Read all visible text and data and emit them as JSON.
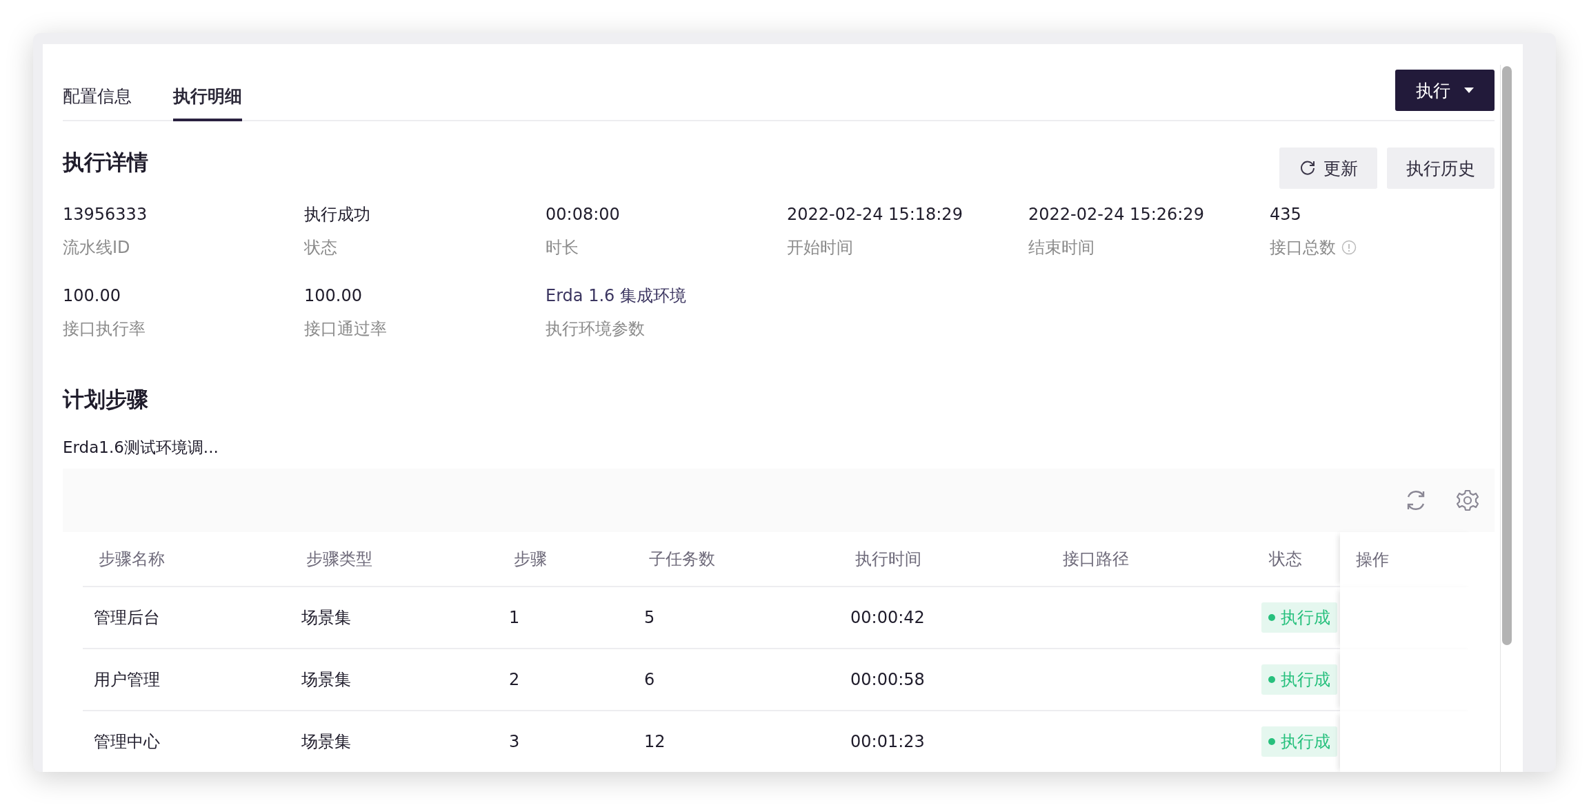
{
  "tabs": [
    {
      "label": "配置信息",
      "selected": false
    },
    {
      "label": "执行明细",
      "selected": true
    }
  ],
  "run_button": {
    "label": "执行"
  },
  "details": {
    "title": "执行详情",
    "buttons": [
      {
        "kind": "refresh",
        "label": "更新"
      },
      {
        "kind": "plain",
        "label": "执行历史"
      }
    ],
    "fields": [
      {
        "value": "13956333",
        "label": "流水线ID",
        "link": false
      },
      {
        "value": "执行成功",
        "label": "状态",
        "link": false
      },
      {
        "value": "00:08:00",
        "label": "时长",
        "link": false
      },
      {
        "value": "2022-02-24 15:18:29",
        "label": "开始时间",
        "link": false
      },
      {
        "value": "2022-02-24 15:26:29",
        "label": "结束时间",
        "link": false
      },
      {
        "value": "435",
        "label": "接口总数",
        "link": false,
        "info": true
      },
      {
        "value": "100.00",
        "label": "接口执行率",
        "link": false
      },
      {
        "value": "100.00",
        "label": "接口通过率",
        "link": false
      },
      {
        "value": "Erda 1.6 集成环境",
        "label": "执行环境参数",
        "link": true
      }
    ]
  },
  "steps": {
    "title": "计划步骤",
    "plan_name": "Erda1.6测试环境调...",
    "table": {
      "columns": [
        "步骤名称",
        "步骤类型",
        "步骤",
        "子任务数",
        "执行时间",
        "接口路径",
        "状态",
        "操作"
      ],
      "rows": [
        {
          "cells": [
            "管理后台",
            "场景集",
            "1",
            "5",
            "00:00:42"
          ],
          "status": {
            "text": "执行成",
            "color": "#27c07d"
          }
        },
        {
          "cells": [
            "用户管理",
            "场景集",
            "2",
            "6",
            "00:00:58"
          ],
          "status": {
            "text": "执行成",
            "color": "#27c07d"
          }
        },
        {
          "cells": [
            "管理中心",
            "场景集",
            "3",
            "12",
            "00:01:23"
          ],
          "status": {
            "text": "执行成",
            "color": "#27c07d"
          }
        }
      ]
    }
  }
}
